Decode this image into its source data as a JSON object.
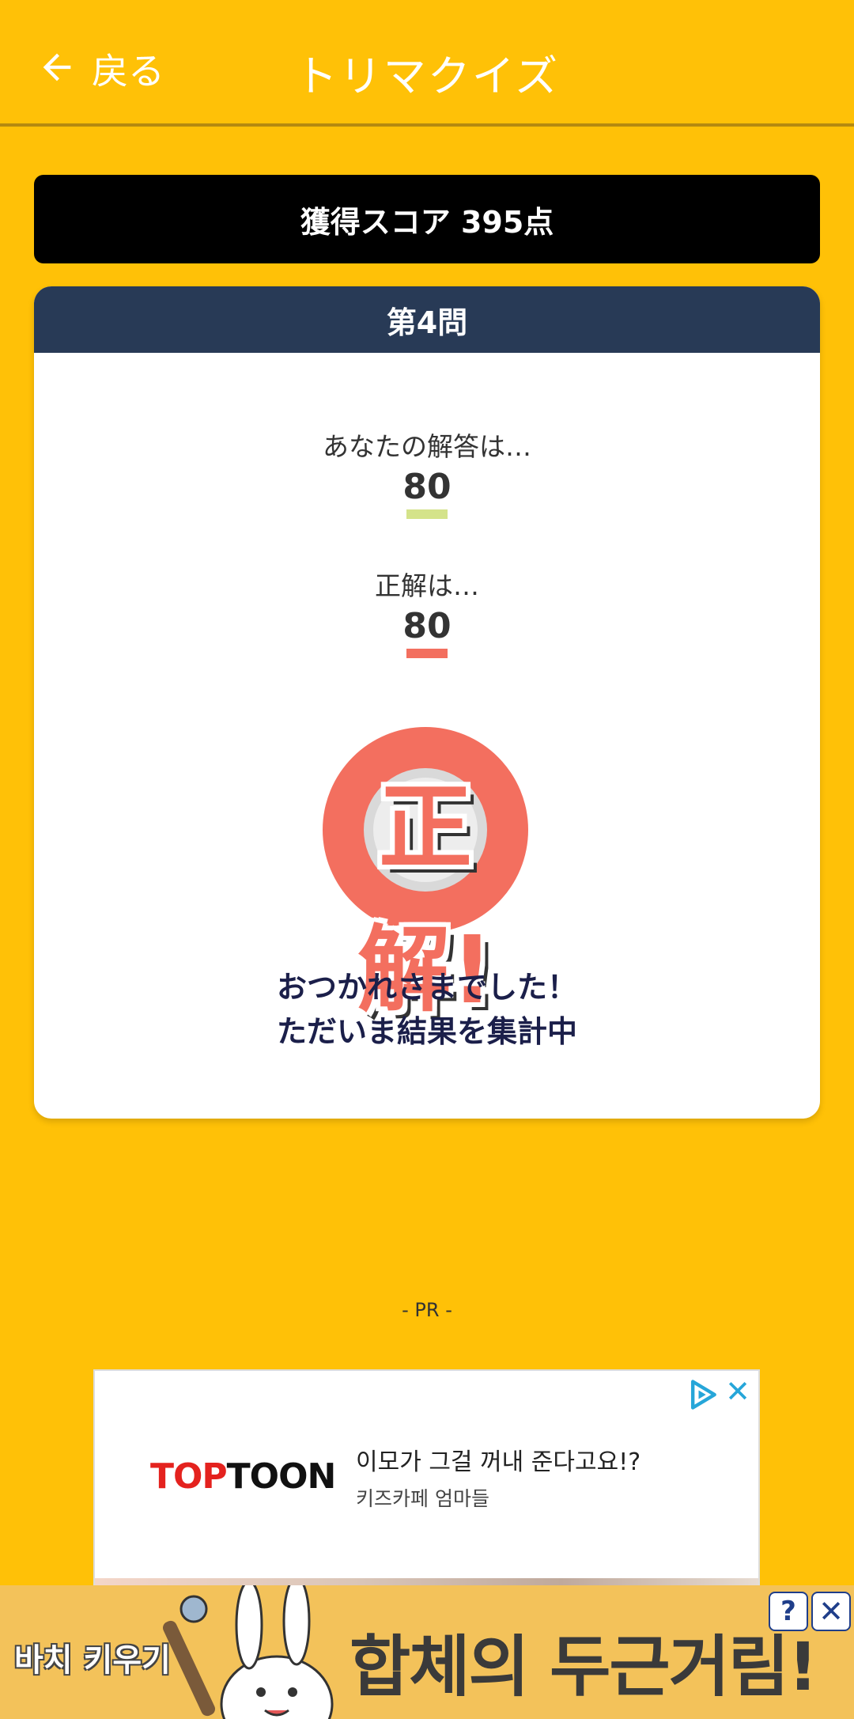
{
  "header": {
    "back_label": "戻る",
    "title": "トリマクイズ"
  },
  "score": {
    "label": "獲得スコア 395点"
  },
  "question": {
    "heading": "第4問",
    "your_answer_label": "あなたの解答は…",
    "your_answer_value": "80",
    "correct_label": "正解は…",
    "correct_value": "80",
    "result_stamp": "正解!",
    "message_line1": "おつかれさまでした！",
    "message_line2": "ただいま結果を集計中"
  },
  "colors": {
    "background": "#FFC107",
    "header_card": "#283A56",
    "your_answer_underline": "#D4E38A",
    "correct_underline": "#F36F5F",
    "message_text": "#1B1F4A"
  },
  "ad": {
    "pr_label": "- PR -",
    "brand_top": "TOP",
    "brand_toon": "TOON",
    "headline": "이모가 그걸 꺼내 준다고요!?",
    "subline": "키즈카페 엄마들",
    "close_glyph": "✕"
  },
  "banner": {
    "logo_text": "바치 키우기",
    "text": "합체의 두근거림!",
    "help_glyph": "?",
    "close_glyph": "✕"
  }
}
